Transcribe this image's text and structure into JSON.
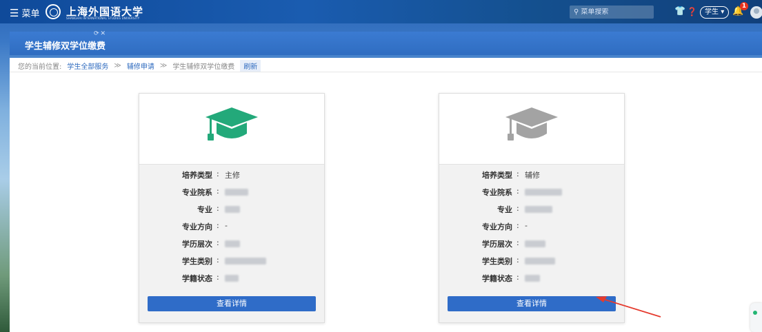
{
  "topbar": {
    "menu_label": "菜单",
    "logo_text": "上海外国语大学",
    "logo_sub": "SHANGHAI INTERNATIONAL STUDIES UNIVERSITY",
    "search_placeholder": "菜单搜索",
    "role_label": "学生",
    "notification_count": "1"
  },
  "page_tab": {
    "title": "学生辅修双学位缴费"
  },
  "breadcrumb": {
    "prefix": "您的当前位置:",
    "items": [
      "学生全部服务",
      "辅修申请",
      "学生辅修双学位缴费"
    ],
    "separator": "≫",
    "refresh": "刷新"
  },
  "cards": [
    {
      "icon_color": "#23a97a",
      "rows": [
        {
          "label": "培养类型",
          "value": "主修"
        },
        {
          "label": "专业院系",
          "value": ""
        },
        {
          "label": "专业",
          "value": ""
        },
        {
          "label": "专业方向",
          "value": "-"
        },
        {
          "label": "学历层次",
          "value": ""
        },
        {
          "label": "学生类别",
          "value": ""
        },
        {
          "label": "学籍状态",
          "value": ""
        }
      ],
      "button_label": "查看详情"
    },
    {
      "icon_color": "#a3a3a3",
      "rows": [
        {
          "label": "培养类型",
          "value": "辅修"
        },
        {
          "label": "专业院系",
          "value": ""
        },
        {
          "label": "专业",
          "value": ""
        },
        {
          "label": "专业方向",
          "value": "-"
        },
        {
          "label": "学历层次",
          "value": ""
        },
        {
          "label": "学生类别",
          "value": ""
        },
        {
          "label": "学籍状态",
          "value": ""
        }
      ],
      "button_label": "查看详情"
    }
  ],
  "colors": {
    "primary": "#2f6cc8",
    "badge": "#e8331d",
    "annotation_arrow": "#e53b2e"
  }
}
